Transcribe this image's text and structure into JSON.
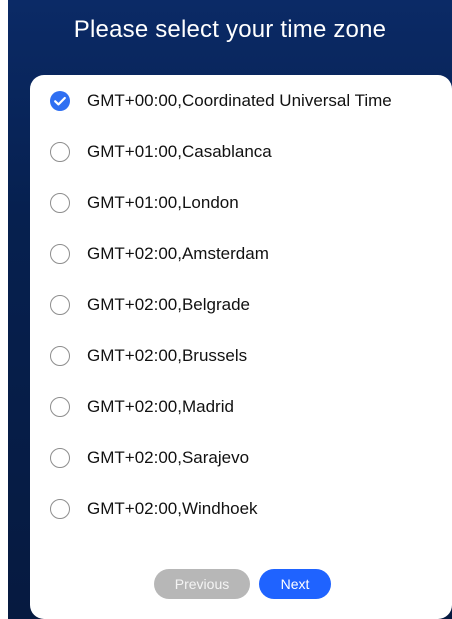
{
  "header": {
    "title": "Please select your time zone"
  },
  "timezones": [
    {
      "label": "GMT+00:00,Coordinated Universal Time",
      "selected": true
    },
    {
      "label": "GMT+01:00,Casablanca",
      "selected": false
    },
    {
      "label": "GMT+01:00,London",
      "selected": false
    },
    {
      "label": "GMT+02:00,Amsterdam",
      "selected": false
    },
    {
      "label": "GMT+02:00,Belgrade",
      "selected": false
    },
    {
      "label": "GMT+02:00,Brussels",
      "selected": false
    },
    {
      "label": "GMT+02:00,Madrid",
      "selected": false
    },
    {
      "label": "GMT+02:00,Sarajevo",
      "selected": false
    },
    {
      "label": "GMT+02:00,Windhoek",
      "selected": false
    }
  ],
  "buttons": {
    "previous": "Previous",
    "next": "Next"
  },
  "colors": {
    "accent": "#2f6ff2",
    "next_button": "#1f63ff",
    "previous_button": "#b7b7b7",
    "header_bg": "#0b2a66"
  }
}
